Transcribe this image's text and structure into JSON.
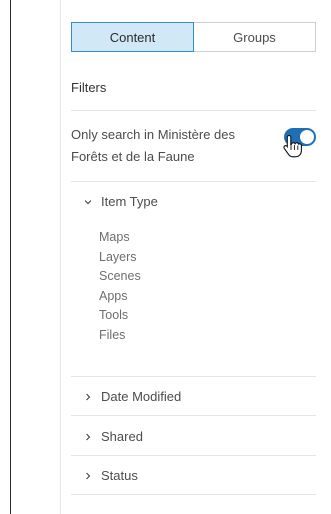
{
  "tabs": [
    {
      "label": "Content",
      "active": true
    },
    {
      "label": "Groups",
      "active": false
    }
  ],
  "filters_heading": "Filters",
  "toggle": {
    "label": "Only search in Ministère des Forêts et de la Faune",
    "on": true
  },
  "groups": {
    "item_type": {
      "label": "Item Type",
      "expanded": true,
      "items": [
        "Maps",
        "Layers",
        "Scenes",
        "Apps",
        "Tools",
        "Files"
      ]
    },
    "date_modified": {
      "label": "Date Modified",
      "expanded": false
    },
    "shared": {
      "label": "Shared",
      "expanded": false
    },
    "status": {
      "label": "Status",
      "expanded": false
    }
  },
  "colors": {
    "accent": "#1f6fb5",
    "active_tab_bg": "#d1e9f7",
    "active_tab_border": "#2f8fcf"
  },
  "icons": {
    "expanded_chevron": "chevron-down-icon",
    "collapsed_chevron": "chevron-right-icon",
    "pointer": "hand-cursor-icon"
  }
}
